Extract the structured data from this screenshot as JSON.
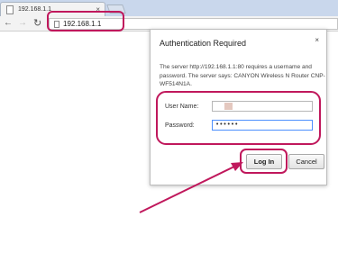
{
  "browser": {
    "tab_title": "192.168.1.1",
    "tab_close": "×",
    "address_url": "192.168.1.1"
  },
  "dialog": {
    "title": "Authentication Required",
    "close_symbol": "×",
    "message": "The server http://192.168.1.1:80 requires a username and password. The server says: CANYON Wireless N Router CNP-WF514N1A.",
    "username_label": "User Name:",
    "password_label": "Password:",
    "password_value": "••••••",
    "login_button": "Log In",
    "cancel_button": "Cancel"
  },
  "annotations": {
    "highlight_color": "#c0185c"
  }
}
